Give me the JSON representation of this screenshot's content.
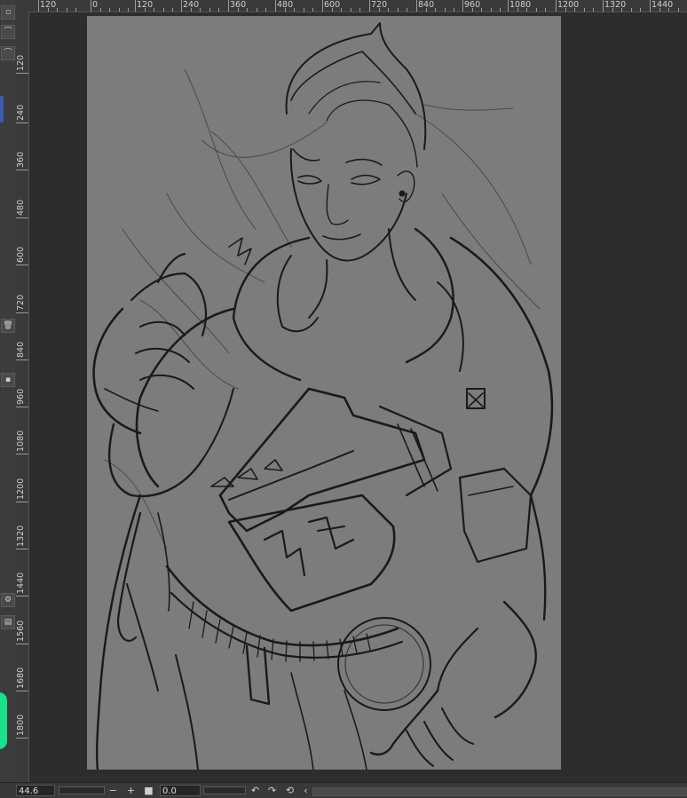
{
  "rulers": {
    "horizontal_labels": [
      "120",
      "0",
      "120",
      "240",
      "360",
      "480",
      "600",
      "720",
      "840",
      "960",
      "1080",
      "1200",
      "1320",
      "1440"
    ],
    "vertical_labels": [
      "120",
      "240",
      "360",
      "480",
      "600",
      "720",
      "840",
      "960",
      "1080",
      "1200",
      "1320",
      "1440",
      "1560",
      "1680",
      "1800"
    ]
  },
  "statusbar": {
    "zoom_value": "44.6",
    "rotation_value": "0.0",
    "zoom_out_icon": "minus-icon",
    "zoom_in_icon": "plus-icon",
    "rotate_left_icon": "rotate-left-icon",
    "rotate_right_icon": "rotate-right-icon",
    "reset_icon": "reset-icon",
    "flip_icon": "chevron-left-icon"
  },
  "canvas": {
    "background_color": "#7c7c7c",
    "line_color": "#1a1a1a"
  },
  "colors": {
    "accent_green": "#19e08a",
    "selection_blue": "#3b5da8"
  }
}
